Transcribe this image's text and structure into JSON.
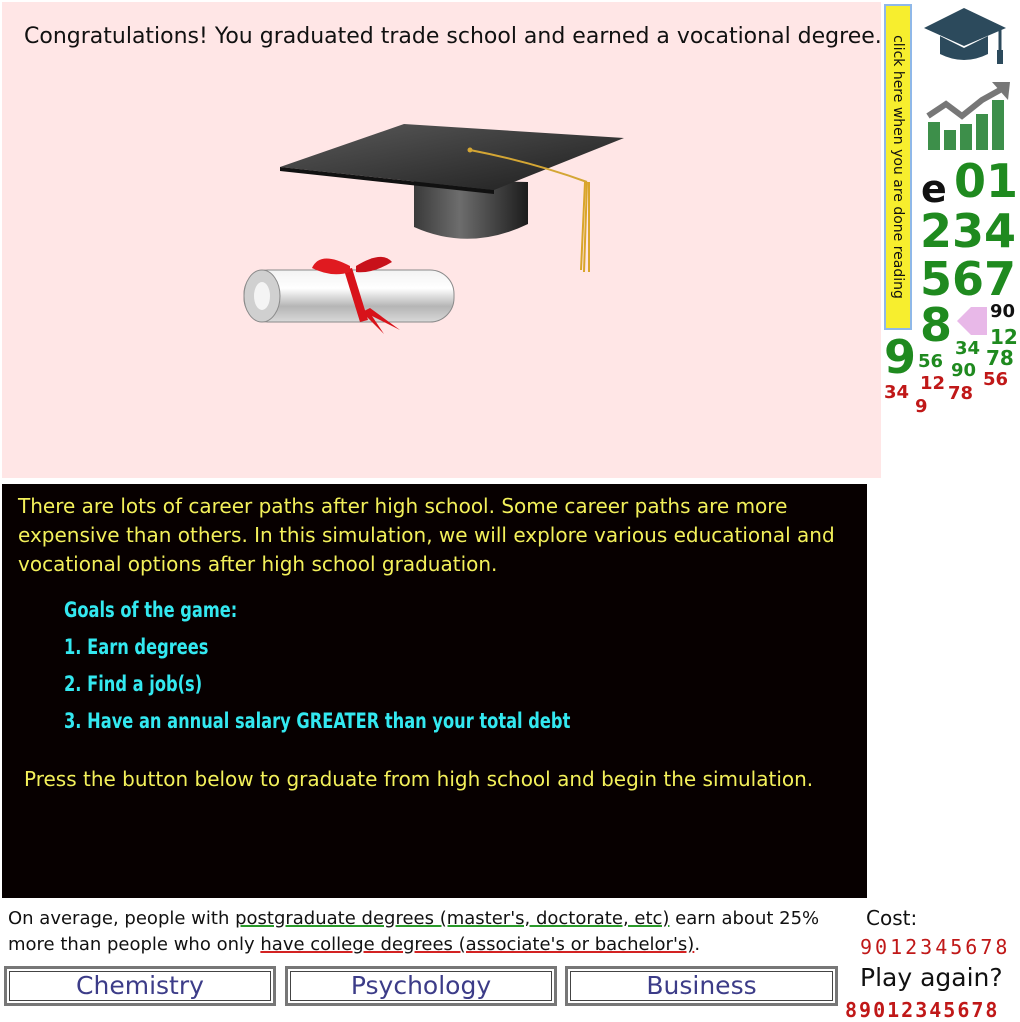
{
  "headline": "Congratulations! You graduated trade school and earned a vocational degree.",
  "done_reading": "click here when you are done reading",
  "intro": "There are lots of career paths after high school.  Some career paths are more expensive than others.  In this simulation, we will explore various educational and vocational options after high school graduation.",
  "goals": {
    "title": "Goals of the game:",
    "items": [
      "1. Earn degrees",
      "2. Find a job(s)",
      "3. Have an annual salary GREATER than your total debt"
    ]
  },
  "press_text": "Press the button below to graduate from high school and begin the simulation.",
  "fact": {
    "part1": "On average, people with ",
    "link1": "postgraduate degrees (master's, doctorate, etc)",
    "part2": " earn about 25% more than people who only ",
    "link2": "have college degrees (associate's or bachelor's)",
    "part3": "."
  },
  "buttons": [
    "Chemistry",
    "Psychology",
    "Business"
  ],
  "cost_label": "Cost:",
  "cost_digits": "9012345678",
  "play_again": "Play again?",
  "play_digits": "89012345678",
  "sidebar_digits": {
    "e": "e",
    "r1": "01",
    "r2": "234",
    "r3": "567",
    "r4": "8",
    "d9": "9",
    "small_90": "90",
    "small_12": "12",
    "small_34a": "34",
    "small_78": "78",
    "small_56a": "56",
    "small_90b": "90",
    "red_56": "56",
    "red_34": "34",
    "red_12": "12",
    "red_78": "78",
    "red_9": "9"
  },
  "colors": {
    "top_bg": "#ffe6e6",
    "panel_bg": "#070000",
    "intro_text": "#f3f05a",
    "goals_text": "#33e8f0",
    "digit_green": "#1f8a1f",
    "digit_red": "#c01818"
  },
  "icons": [
    "graduation-cap-icon",
    "growth-chart-icon",
    "back-arrow-icon",
    "diploma-icon"
  ]
}
